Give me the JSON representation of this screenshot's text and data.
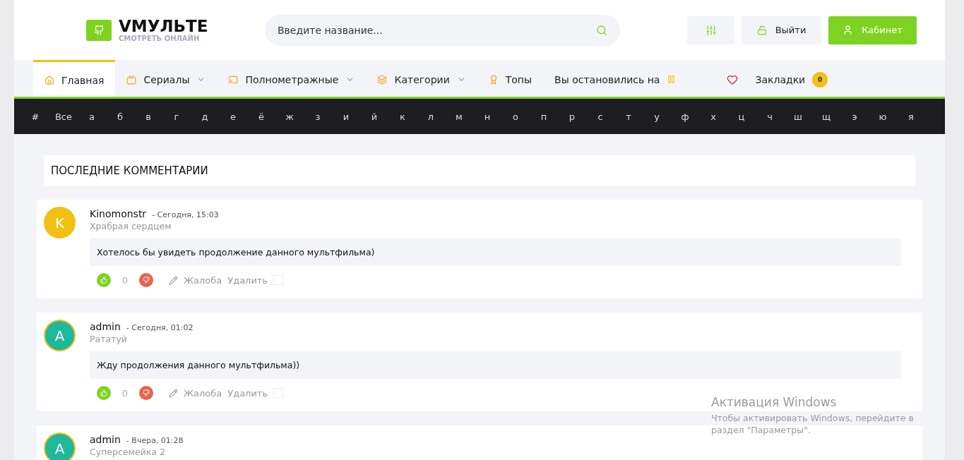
{
  "logo": {
    "title": "VМУЛЬТЕ",
    "subtitle": "СМОТРЕТЬ ОНЛАЙН"
  },
  "search": {
    "placeholder": "Введите название..."
  },
  "header_buttons": [
    {
      "kind": "filter"
    },
    {
      "kind": "logout",
      "label": "Выйти"
    },
    {
      "kind": "cabinet",
      "label": "Кабинет"
    }
  ],
  "nav": [
    {
      "label": "Главная",
      "selected": true,
      "dropdown": false
    },
    {
      "label": "Сериалы",
      "selected": false,
      "dropdown": true
    },
    {
      "label": "Полнометражные",
      "selected": false,
      "dropdown": true
    },
    {
      "label": "Категории",
      "selected": false,
      "dropdown": true
    },
    {
      "label": "Топы",
      "selected": false,
      "dropdown": false
    },
    {
      "label": "Вы остановились на",
      "selected": false,
      "dropdown": false
    },
    {
      "label": "Закладки",
      "selected": false,
      "dropdown": false,
      "badge": "0"
    }
  ],
  "alphabet": [
    "#",
    "Все",
    "а",
    "б",
    "в",
    "г",
    "д",
    "е",
    "ё",
    "ж",
    "з",
    "и",
    "й",
    "к",
    "л",
    "м",
    "н",
    "о",
    "п",
    "р",
    "с",
    "т",
    "у",
    "ф",
    "х",
    "ц",
    "ч",
    "ш",
    "щ",
    "э",
    "ю",
    "я"
  ],
  "section_title": "ПОСЛЕДНИЕ КОММЕНТАРИИ",
  "comments": [
    {
      "avatar": "K",
      "color": "#f2c015",
      "author": "Kinomonstr",
      "date": "- Сегодня, 15:03",
      "title": "Храбрая сердцем",
      "text": "Хотелось бы увидеть продолжение данного мультфильма)",
      "rating": "0",
      "actions": [
        "Жалоба",
        "Удалить"
      ],
      "checked": false
    },
    {
      "avatar": "A",
      "color": "#1fb89b",
      "author": "admin",
      "date": "- Сегодня, 01:02",
      "title": "Рататуй",
      "text": "Жду продолжения данного мультфильма))",
      "rating": "0",
      "actions": [
        "Жалоба",
        "Удалить"
      ],
      "checked": false
    },
    {
      "avatar": "A",
      "color": "#1fb89b",
      "author": "admin",
      "date": "- Вчера, 01:28",
      "title": "Суперсемейка 2"
    }
  ],
  "os_notice": {
    "title": "Активация Windows",
    "lines": [
      "Чтобы активировать Windows, перейдите в",
      "раздел \"Параметры\"."
    ]
  }
}
